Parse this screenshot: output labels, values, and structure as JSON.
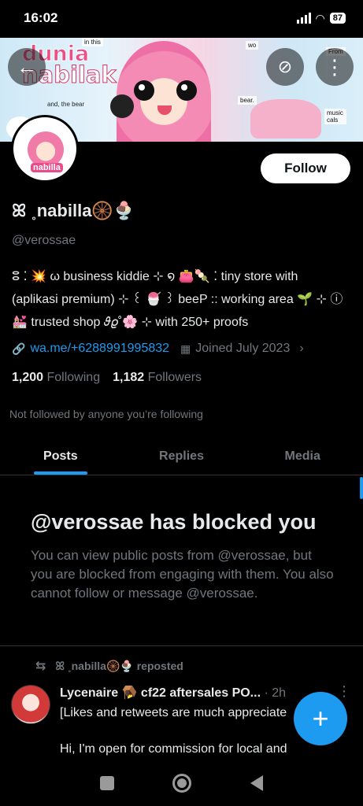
{
  "status_bar": {
    "time": "16:02",
    "battery": "87"
  },
  "banner": {
    "title_line1": "dunia",
    "title_line2": "nabilak",
    "subtitle": "and, the bear",
    "notes": [
      "wo",
      "From",
      "bear.",
      "music cals",
      "in this"
    ]
  },
  "header": {
    "back_icon": "arrow-left-icon",
    "hide_icon": "eye-off-icon",
    "more_icon": "more-vertical-icon"
  },
  "avatar": {
    "tag": "nabilla"
  },
  "profile": {
    "follow_label": "Follow",
    "display_name": "ꕤ ˳nabilla🛞🍨",
    "handle": "@verossae",
    "bio_line1": "ⵓ ⁚ 💥 ω business kiddie ⊹ ໑ 👛🍡 ⁚ tiny store with",
    "bio_line2": "(aplikasi premium) ⊹ ꒰ 🍧 ꒱ beeP :: working area 🌱 ⊹ ⓘ",
    "bio_line3": "💒 trusted shop 𝜗𝜚˚🌸 ⊹ with 250+ proofs",
    "link": "wa.me/+6288991995832",
    "joined": "Joined July 2023",
    "following_count": "1,200",
    "following_label": "Following",
    "followers_count": "1,182",
    "followers_label": "Followers",
    "followed_note": "Not followed by anyone you’re following"
  },
  "tabs": [
    {
      "label": "Posts",
      "active": true
    },
    {
      "label": "Replies",
      "active": false
    },
    {
      "label": "Media",
      "active": false
    }
  ],
  "blocked": {
    "title": "@verossae has blocked you",
    "text": "You can view public posts from @verossae, but you are blocked from engaging with them. You also cannot follow or message @verossae."
  },
  "post": {
    "repost_label": "ꕤ ˳nabilla🛞🍨 reposted",
    "author": "Lycenaire 🪤 cf22 aftersales PO...",
    "time": "· 2h",
    "line1": "[Likes and retweets are much appreciate",
    "line2": "Hi, I'm open for commission for local and"
  },
  "fab": {
    "label": "+"
  },
  "colors": {
    "accent": "#1d9bf0",
    "background": "#000000",
    "muted": "#71767b",
    "text": "#e7e9ea"
  }
}
